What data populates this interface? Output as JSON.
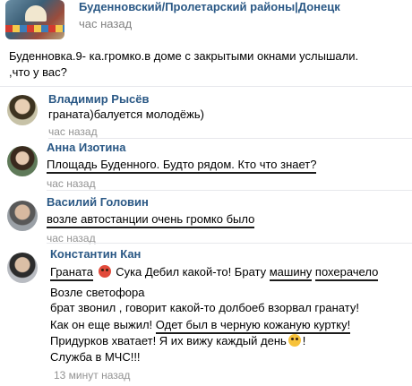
{
  "post": {
    "group_name": "Буденновский/Пролетарский районы|Донецк",
    "time": "час назад",
    "text_line1": "Буденновка.9- ка.громко.в доме с закрытыми окнами услышали.",
    "text_line2": ",что у вас?"
  },
  "comments": [
    {
      "author": "Владимир Рысёв",
      "lines": [
        "граната)балуется молодёжь)"
      ],
      "time": "час назад"
    },
    {
      "author": "Анна Изотина",
      "lines": [
        "Площадь Буденного. Будто рядом. Кто что знает?"
      ],
      "time": "час назад"
    },
    {
      "author": "Василий Головин",
      "lines": [
        "возле автостанции очень громко было"
      ],
      "time": "час назад"
    },
    {
      "author": "Константин Кан",
      "line1": {
        "a": "Граната",
        "b": "Сука Дебил какой-то! Брату",
        "c": "машину",
        "d": "похерачело"
      },
      "line2": "Возле светофора",
      "line3": "брат звонил , говорит какой-то долбоеб взорвал гранату!",
      "line4": {
        "a": "Как он еще выжил!",
        "b": "Одет был в черную кожаную куртку!"
      },
      "line5": "Придурков хватает! Я их вижу каждый день",
      "line5_end": "!",
      "line6": "Служба в МЧС!!!",
      "time": "13 минут назад"
    }
  ],
  "icons": {
    "emoji_angry": "angry-face",
    "emoji_laugh": "laughing-face"
  },
  "colors": {
    "link": "#2a5885",
    "meta": "#828282",
    "underline": "#1c1c1c",
    "separator": "#e7e8ec"
  }
}
